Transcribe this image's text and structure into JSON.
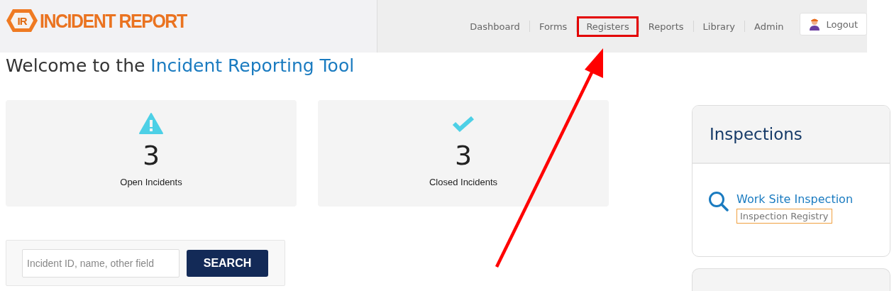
{
  "logo": {
    "mark": "IR",
    "name": "INCIDENT REPORT"
  },
  "nav": [
    {
      "label": "Dashboard",
      "highlighted": false
    },
    {
      "label": "Forms",
      "highlighted": false
    },
    {
      "label": "Registers",
      "highlighted": true
    },
    {
      "label": "Reports",
      "highlighted": false
    },
    {
      "label": "Library",
      "highlighted": false
    },
    {
      "label": "Admin",
      "highlighted": false
    }
  ],
  "logout": {
    "label": "Logout"
  },
  "heading": {
    "prefix": "Welcome to the",
    "highlight": "Incident Reporting Tool"
  },
  "stats": [
    {
      "kind": "warning",
      "count": "3",
      "label": "Open Incidents"
    },
    {
      "kind": "check",
      "count": "3",
      "label": "Closed Incidents"
    }
  ],
  "search": {
    "placeholder": "Incident ID, name, other field",
    "button": "SEARCH"
  },
  "inspections": {
    "title": "Inspections",
    "items": [
      {
        "title": "Work Site Inspection",
        "link": "Inspection Registry"
      }
    ]
  },
  "annotations": [
    {
      "kind": "arrow"
    }
  ]
}
